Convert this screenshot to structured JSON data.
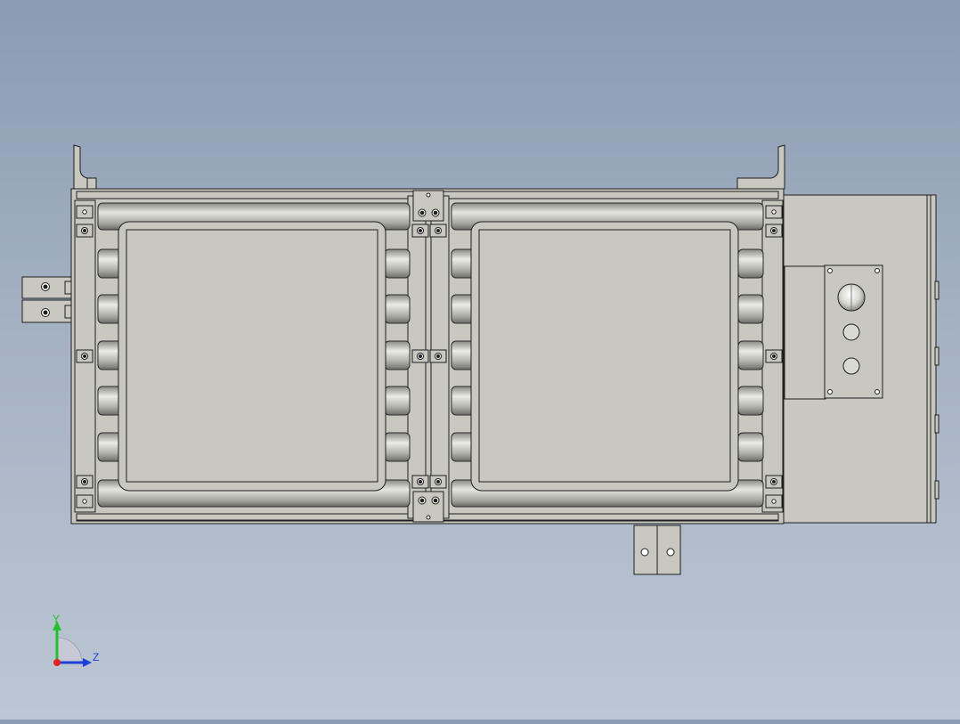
{
  "colors": {
    "background_top": "#8b9bb1",
    "background_bottom": "#bcc6d4",
    "part_fill": "#c8c8c0",
    "edge": "#1e1e1e",
    "axis_y": "#22c22c",
    "axis_z": "#1f3fd9",
    "axis_x": "#e32020"
  },
  "triad": {
    "y_label": "Y",
    "z_label": "Z"
  }
}
